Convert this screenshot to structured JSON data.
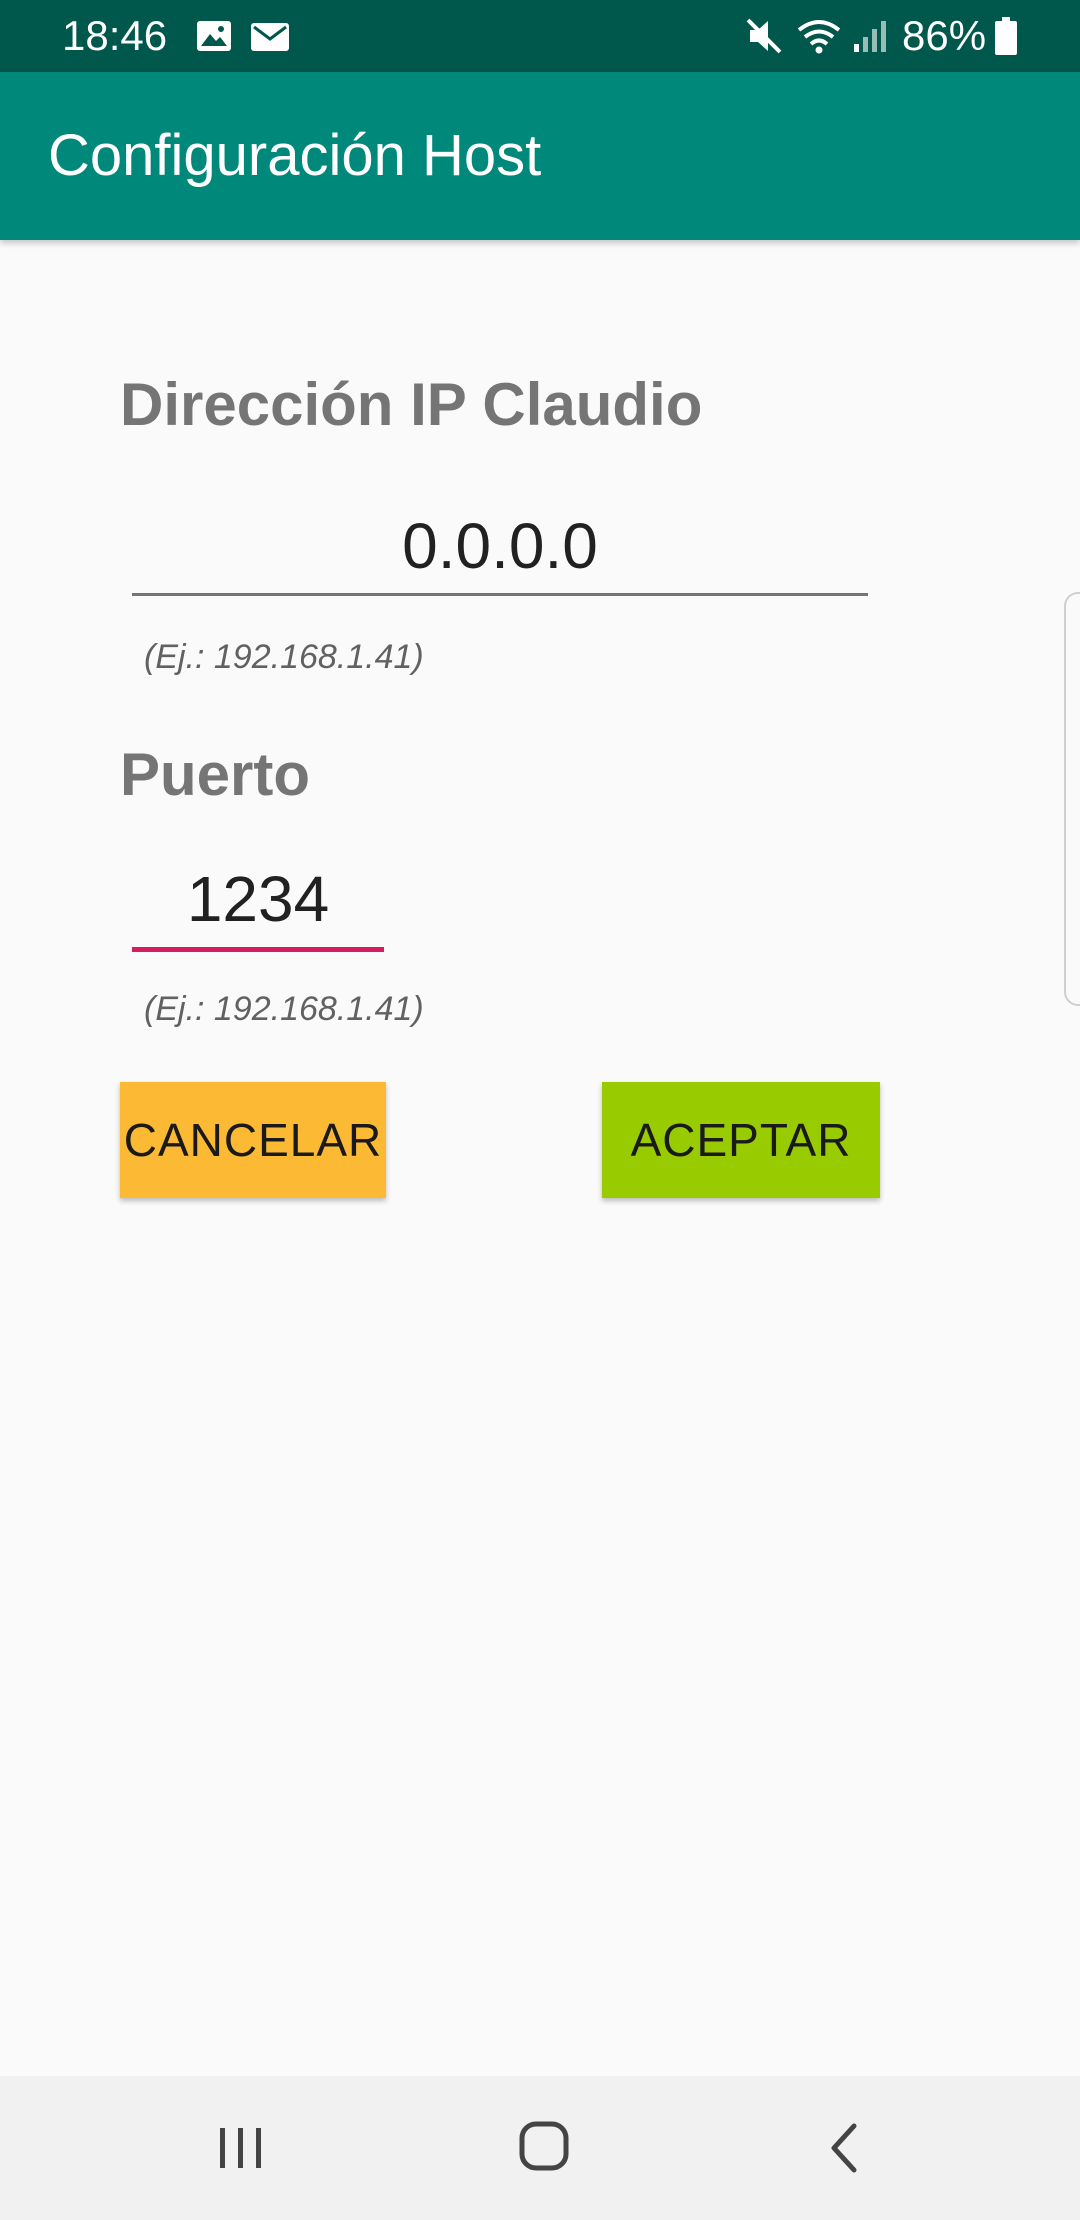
{
  "status_bar": {
    "time": "18:46",
    "battery": "86%",
    "icons": [
      "image-icon",
      "mail-icon",
      "mute-icon",
      "wifi-icon",
      "signal-icon",
      "battery-icon"
    ]
  },
  "app_bar": {
    "title": "Configuración Host",
    "color": "#00897b"
  },
  "form": {
    "ip_label": "Dirección IP Claudio",
    "ip_value": "0.0.0.0",
    "ip_hint": "(Ej.: 192.168.1.41)",
    "port_label": "Puerto",
    "port_value": "1234",
    "port_hint": "(Ej.: 192.168.1.41)"
  },
  "buttons": {
    "cancel_label": "CANCELAR",
    "cancel_color": "#fbb934",
    "accept_label": "ACEPTAR",
    "accept_color": "#99cc00"
  },
  "nav_bar": {
    "icons": [
      "recents-icon",
      "home-icon",
      "back-icon"
    ]
  }
}
